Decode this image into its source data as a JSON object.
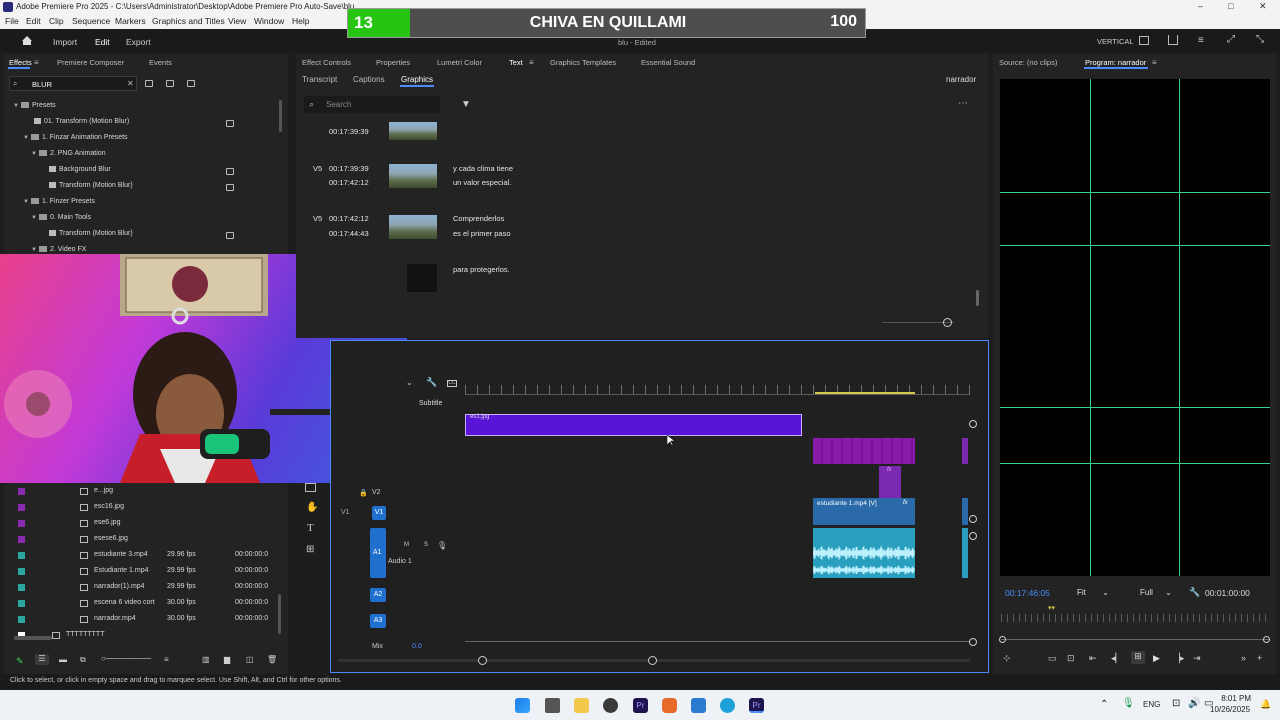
{
  "window": {
    "title": "Adobe Premiere Pro 2025 - C:\\Users\\Administrator\\Desktop\\Adobe Premiere Pro Auto-Save\\blu",
    "controls": [
      "–",
      "□",
      "✕"
    ]
  },
  "menu": [
    "File",
    "Edit",
    "Clip",
    "Sequence",
    "Markers",
    "Graphics and Titles",
    "View",
    "Window",
    "Help"
  ],
  "scoreboard": {
    "count": "13",
    "name": "CHIVA EN QUILLAMI",
    "score": "100"
  },
  "workspace": {
    "import": "Import",
    "edit": "Edit",
    "export": "Export",
    "doc_title": "blu - Edited",
    "vertical": "VERTICAL"
  },
  "effects_panel": {
    "tabs": [
      "Effects",
      "Premiere Composer",
      "Events"
    ],
    "search_value": "BLUR",
    "tree": [
      {
        "label": "Presets",
        "indent": 0
      },
      {
        "label": "01. Transform (Motion Blur)",
        "indent": 1
      },
      {
        "label": "1. Finzar Animation Presets",
        "indent": 1
      },
      {
        "label": "2. PNG Animation",
        "indent": 2
      },
      {
        "label": "Background Blur",
        "indent": 3
      },
      {
        "label": "Transform (Motion Blur)",
        "indent": 3
      },
      {
        "label": "1. Finzer Presets",
        "indent": 1
      },
      {
        "label": "0. Main Tools",
        "indent": 2
      },
      {
        "label": "Transform (Motion Blur)",
        "indent": 3
      },
      {
        "label": "2. Video FX",
        "indent": 2
      }
    ]
  },
  "project_items": [
    {
      "name": "e...jpg",
      "fps": "",
      "start": ""
    },
    {
      "name": "esc16.jpg",
      "fps": "",
      "start": ""
    },
    {
      "name": "ese6.jpg",
      "fps": "",
      "start": ""
    },
    {
      "name": "esese6.jpg",
      "fps": "",
      "start": ""
    },
    {
      "name": "estudiante 3.mp4",
      "fps": "29.96 fps",
      "start": "00:00:00:0"
    },
    {
      "name": "Estudiante 1.mp4",
      "fps": "29.99 fps",
      "start": "00:00:00:0"
    },
    {
      "name": "narrador(1).mp4",
      "fps": "29.99 fps",
      "start": "00:00:00:0"
    },
    {
      "name": "escena 6 video cort",
      "fps": "30.00 fps",
      "start": "00:00:00:0"
    },
    {
      "name": "narrador.mp4",
      "fps": "30.00 fps",
      "start": "00:00:00:0"
    },
    {
      "name": "TTTTTTTTT",
      "fps": "",
      "start": ""
    }
  ],
  "center_panel": {
    "tabs": [
      "Effect Controls",
      "Properties",
      "Lumetri Color",
      "Text",
      "Graphics Templates",
      "Essential Sound"
    ],
    "subtabs": [
      "Transcript",
      "Captions",
      "Graphics"
    ],
    "sequence": "narrador",
    "search_placeholder": "Search",
    "captions": [
      {
        "track": "",
        "in": "00:17:39:39",
        "out": "",
        "text1": "",
        "text2": ""
      },
      {
        "track": "V5",
        "in": "00:17:39:39",
        "out": "00:17:42:12",
        "text1": "y cada clima tiene",
        "text2": "un valor especial."
      },
      {
        "track": "V5",
        "in": "00:17:42:12",
        "out": "00:17:44:43",
        "text1": "Comprenderlos",
        "text2": "es el primer paso"
      },
      {
        "track": "",
        "in": "",
        "out": "",
        "text1": "para protegerlos.",
        "text2": ""
      }
    ]
  },
  "timeline": {
    "subtitle_label": "Subtitle",
    "tracks": {
      "v2": "V2",
      "v1": "V1",
      "a1": "A1",
      "a1_name": "Audio 1",
      "a2": "A2",
      "a3": "A3",
      "mix": "Mix",
      "mix_val": "0.0"
    },
    "clip_label": "estudiante 1.mp4 [V]",
    "clip_top_label": "es1.jpg",
    "fx": "fx"
  },
  "program_monitor": {
    "source_tab": "Source: (no clips)",
    "program_tab": "Program: narrador",
    "timecode": "00:17:46:05",
    "fit": "Fit",
    "quality": "Full",
    "duration": "00:01:00:00"
  },
  "status_bar": "Click to select, or click in empty space and drag to marquee select. Use Shift, Alt, and Ctrl for other options.",
  "taskbar": {
    "lang": "ENG",
    "time": "8:01 PM",
    "date": "10/26/2025"
  }
}
